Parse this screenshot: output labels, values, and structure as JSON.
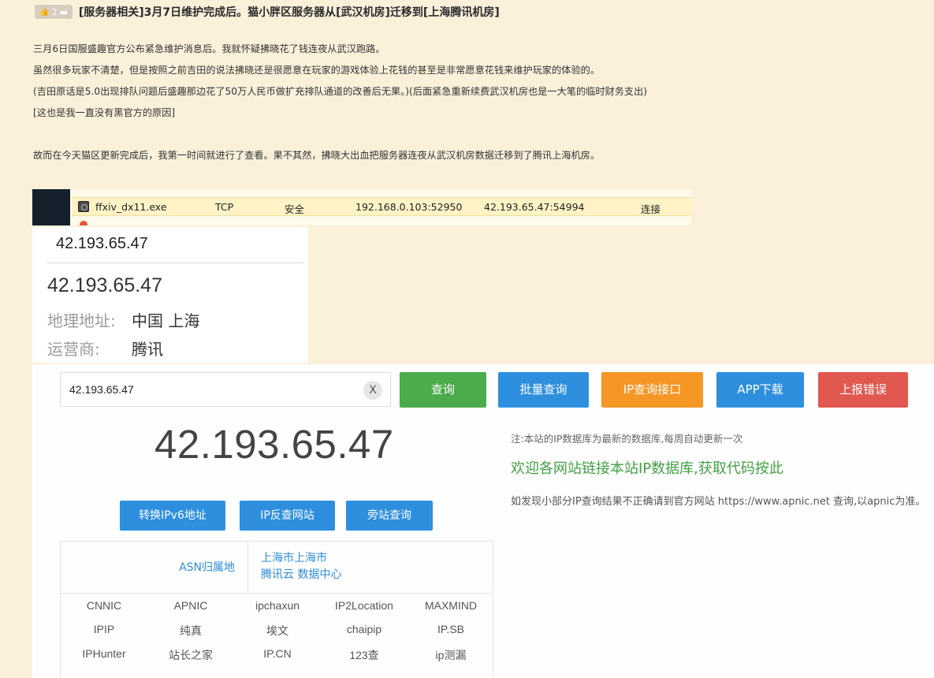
{
  "post": {
    "vote_count": "2",
    "title": "[服务器相关]3月7日维护完成后。猫小胖区服务器从[武汉机房]迁移到[上海腾讯机房]",
    "lines": [
      "三月6日国服盛趣官方公布紧急维护消息后。我就怀疑拂晓花了钱连夜从武汉跑路。",
      "虽然很多玩家不清楚，但是按照之前吉田的说法拂晓还是很愿意在玩家的游戏体验上花钱的甚至是非常愿意花钱来维护玩家的体验的。",
      "(吉田原话是5.0出现排队问题后盛趣那边花了50万人民币做扩充排队通道的改善后无果。)(后面紧急重新续费武汉机房也是一大笔的临时财务支出)",
      "[这也是我一直没有黑官方的原因]",
      "故而在今天猫区更新完成后，我第一时间就进行了查看。果不其然，拂晓大出血把服务器连夜从武汉机房数据迁移到了腾讯上海机房。"
    ]
  },
  "process": {
    "name": "ffxiv_dx11.exe",
    "protocol": "TCP",
    "safety": "安全",
    "local": "192.168.0.103:52950",
    "remote": "42.193.65.47:54994",
    "state": "连接"
  },
  "lookup1": {
    "input_value": "42.193.65.47",
    "ip": "42.193.65.47",
    "geo_label": "地理地址:",
    "geo_value": "中国 上海",
    "isp_label": "运营商:",
    "isp_value": "腾讯"
  },
  "lookup2": {
    "search_value": "42.193.65.47",
    "clear_glyph": "X",
    "buttons": {
      "query": "查询",
      "batch": "批量查询",
      "api": "IP查询接口",
      "app": "APP下载",
      "report": "上报错误",
      "ipv6": "转换IPv6地址",
      "reverse": "IP反查网站",
      "sibling": "旁站查询"
    },
    "ip": "42.193.65.47",
    "note1": "注:本站的IP数据库为最新的数据库,每周自动更新一次",
    "note2": "欢迎各网站链接本站IP数据库,获取代码按此",
    "note3": "如发现小部分IP查询结果不正确请到官方网站 https://www.apnic.net 查询,以apnic为准。",
    "asn_label": "ASN归属地",
    "asn_line1": "上海市上海市",
    "asn_line2": "腾讯云 数据中心",
    "sources": [
      [
        "CNNIC",
        "APNIC",
        "ipchaxun",
        "IP2Location",
        "MAXMIND"
      ],
      [
        "IPIP",
        "纯真",
        "埃文",
        "chaipip",
        "IP.SB"
      ],
      [
        "IPHunter",
        "站长之家",
        "IP.CN",
        "123查",
        "ip测漏"
      ]
    ]
  },
  "colors": {
    "page_bg": "#fbf0da",
    "green": "#4bab4d",
    "blue": "#2e8fdf",
    "orange": "#f59625",
    "red": "#e0584f",
    "link_blue": "#2f8cd8",
    "note_green": "#43a047"
  }
}
